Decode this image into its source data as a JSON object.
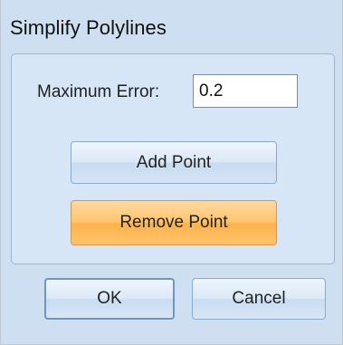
{
  "dialog": {
    "title": "Simplify Polylines",
    "maximum_error": {
      "label": "Maximum Error:",
      "value": "0.2"
    },
    "buttons": {
      "add_point": "Add Point",
      "remove_point": "Remove Point",
      "ok": "OK",
      "cancel": "Cancel"
    }
  },
  "colors": {
    "dialog_background": "#cfdff2",
    "panel_background": "#d7e6f6",
    "highlight_button": "#ffc56f"
  }
}
